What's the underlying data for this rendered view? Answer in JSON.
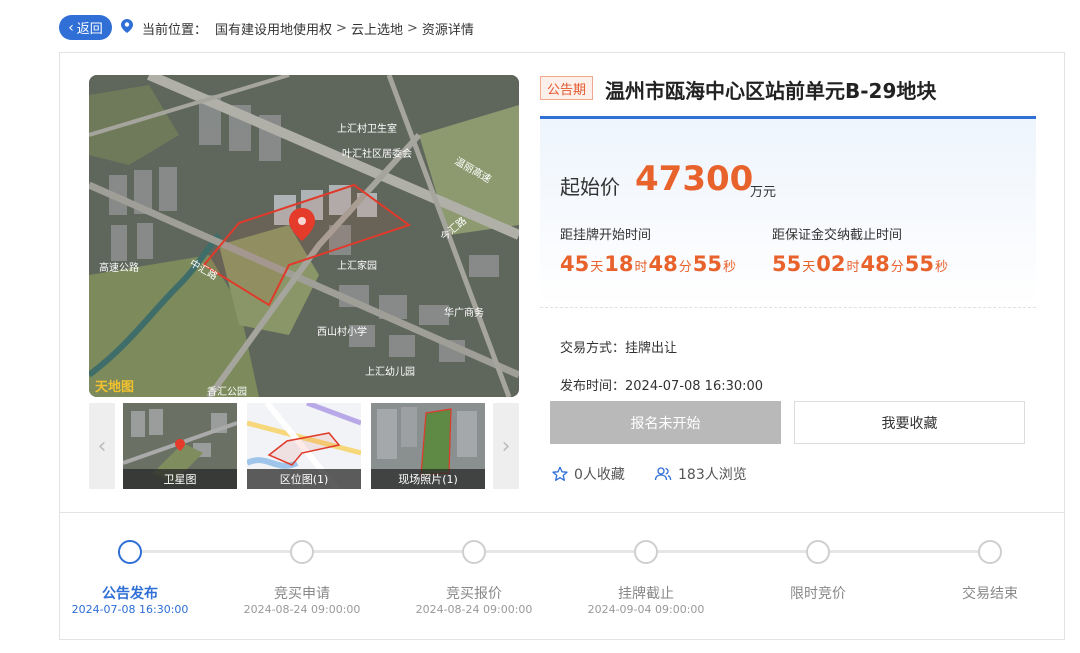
{
  "nav": {
    "back_label": "返回",
    "location_label": "当前位置：",
    "crumbs": [
      "国有建设用地使用权",
      "云上选地",
      "资源详情"
    ]
  },
  "map": {
    "labels": [
      "上汇村卫生室",
      "叶汇社区居委会",
      "温丽高速",
      "中汇路",
      "上汇家园",
      "高速公路",
      "华广商务",
      "今汇路",
      "香汇公园",
      "西山村小学",
      "上汇幼儿园"
    ],
    "watermark": "天地图"
  },
  "thumbnails": [
    {
      "label": "卫星图"
    },
    {
      "label": "区位图(1)"
    },
    {
      "label": "现场照片(1)"
    }
  ],
  "listing": {
    "status": "公告期",
    "title": "温州市瓯海中心区站前单元B-29地块",
    "price_label": "起始价",
    "price_value": "47300",
    "price_unit": "万元",
    "countdown_listing_label": "距挂牌开始时间",
    "countdown_listing": {
      "days": "45",
      "hours": "18",
      "minutes": "48",
      "seconds": "55"
    },
    "countdown_deposit_label": "距保证金交纳截止时间",
    "countdown_deposit": {
      "days": "55",
      "hours": "02",
      "minutes": "48",
      "seconds": "55"
    },
    "unit_day": "天",
    "unit_hour": "时",
    "unit_minute": "分",
    "unit_second": "秒",
    "trade_mode": "交易方式：挂牌出让",
    "publish_time": "发布时间：2024-07-08 16:30:00",
    "signup_button": "报名未开始",
    "favorite_button": "我要收藏",
    "favorites": "0人收藏",
    "views": "183人浏览"
  },
  "timeline": [
    {
      "name": "公告发布",
      "date": "2024-07-08 16:30:00",
      "active": true
    },
    {
      "name": "竞买申请",
      "date": "2024-08-24 09:00:00",
      "active": false
    },
    {
      "name": "竞买报价",
      "date": "2024-08-24 09:00:00",
      "active": false
    },
    {
      "name": "挂牌截止",
      "date": "2024-09-04 09:00:00",
      "active": false
    },
    {
      "name": "限时竞价",
      "date": "",
      "active": false
    },
    {
      "name": "交易结束",
      "date": "",
      "active": false
    }
  ],
  "colors": {
    "accent": "#2f6fd6",
    "price": "#e8622c",
    "tag": "#e2582f",
    "disabled": "#b9b9b9"
  }
}
